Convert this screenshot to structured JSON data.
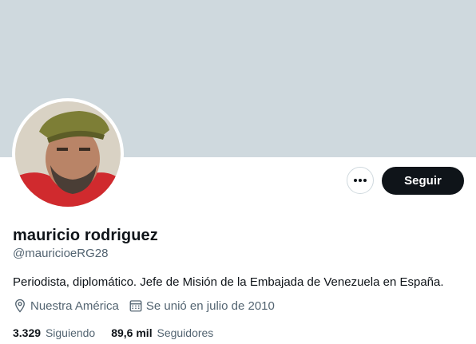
{
  "profile": {
    "name": "mauricio rodriguez",
    "handle": "@mauricioeRG28",
    "bio": "Periodista, diplomático. Jefe de Misión de la Embajada de Venezuela en España.",
    "location": "Nuestra América",
    "joined": "Se unió en julio de 2010"
  },
  "stats": {
    "following_count": "3.329",
    "following_label": "Siguiendo",
    "followers_count": "89,6 mil",
    "followers_label": "Seguidores"
  },
  "actions": {
    "follow_label": "Seguir",
    "more_icon": "more-horizontal-icon"
  },
  "icons": {
    "location": "location-pin-icon",
    "joined": "calendar-icon"
  },
  "colors": {
    "banner": "#cfd9de",
    "follow_button": "#0f1419",
    "secondary_text": "#536471"
  }
}
